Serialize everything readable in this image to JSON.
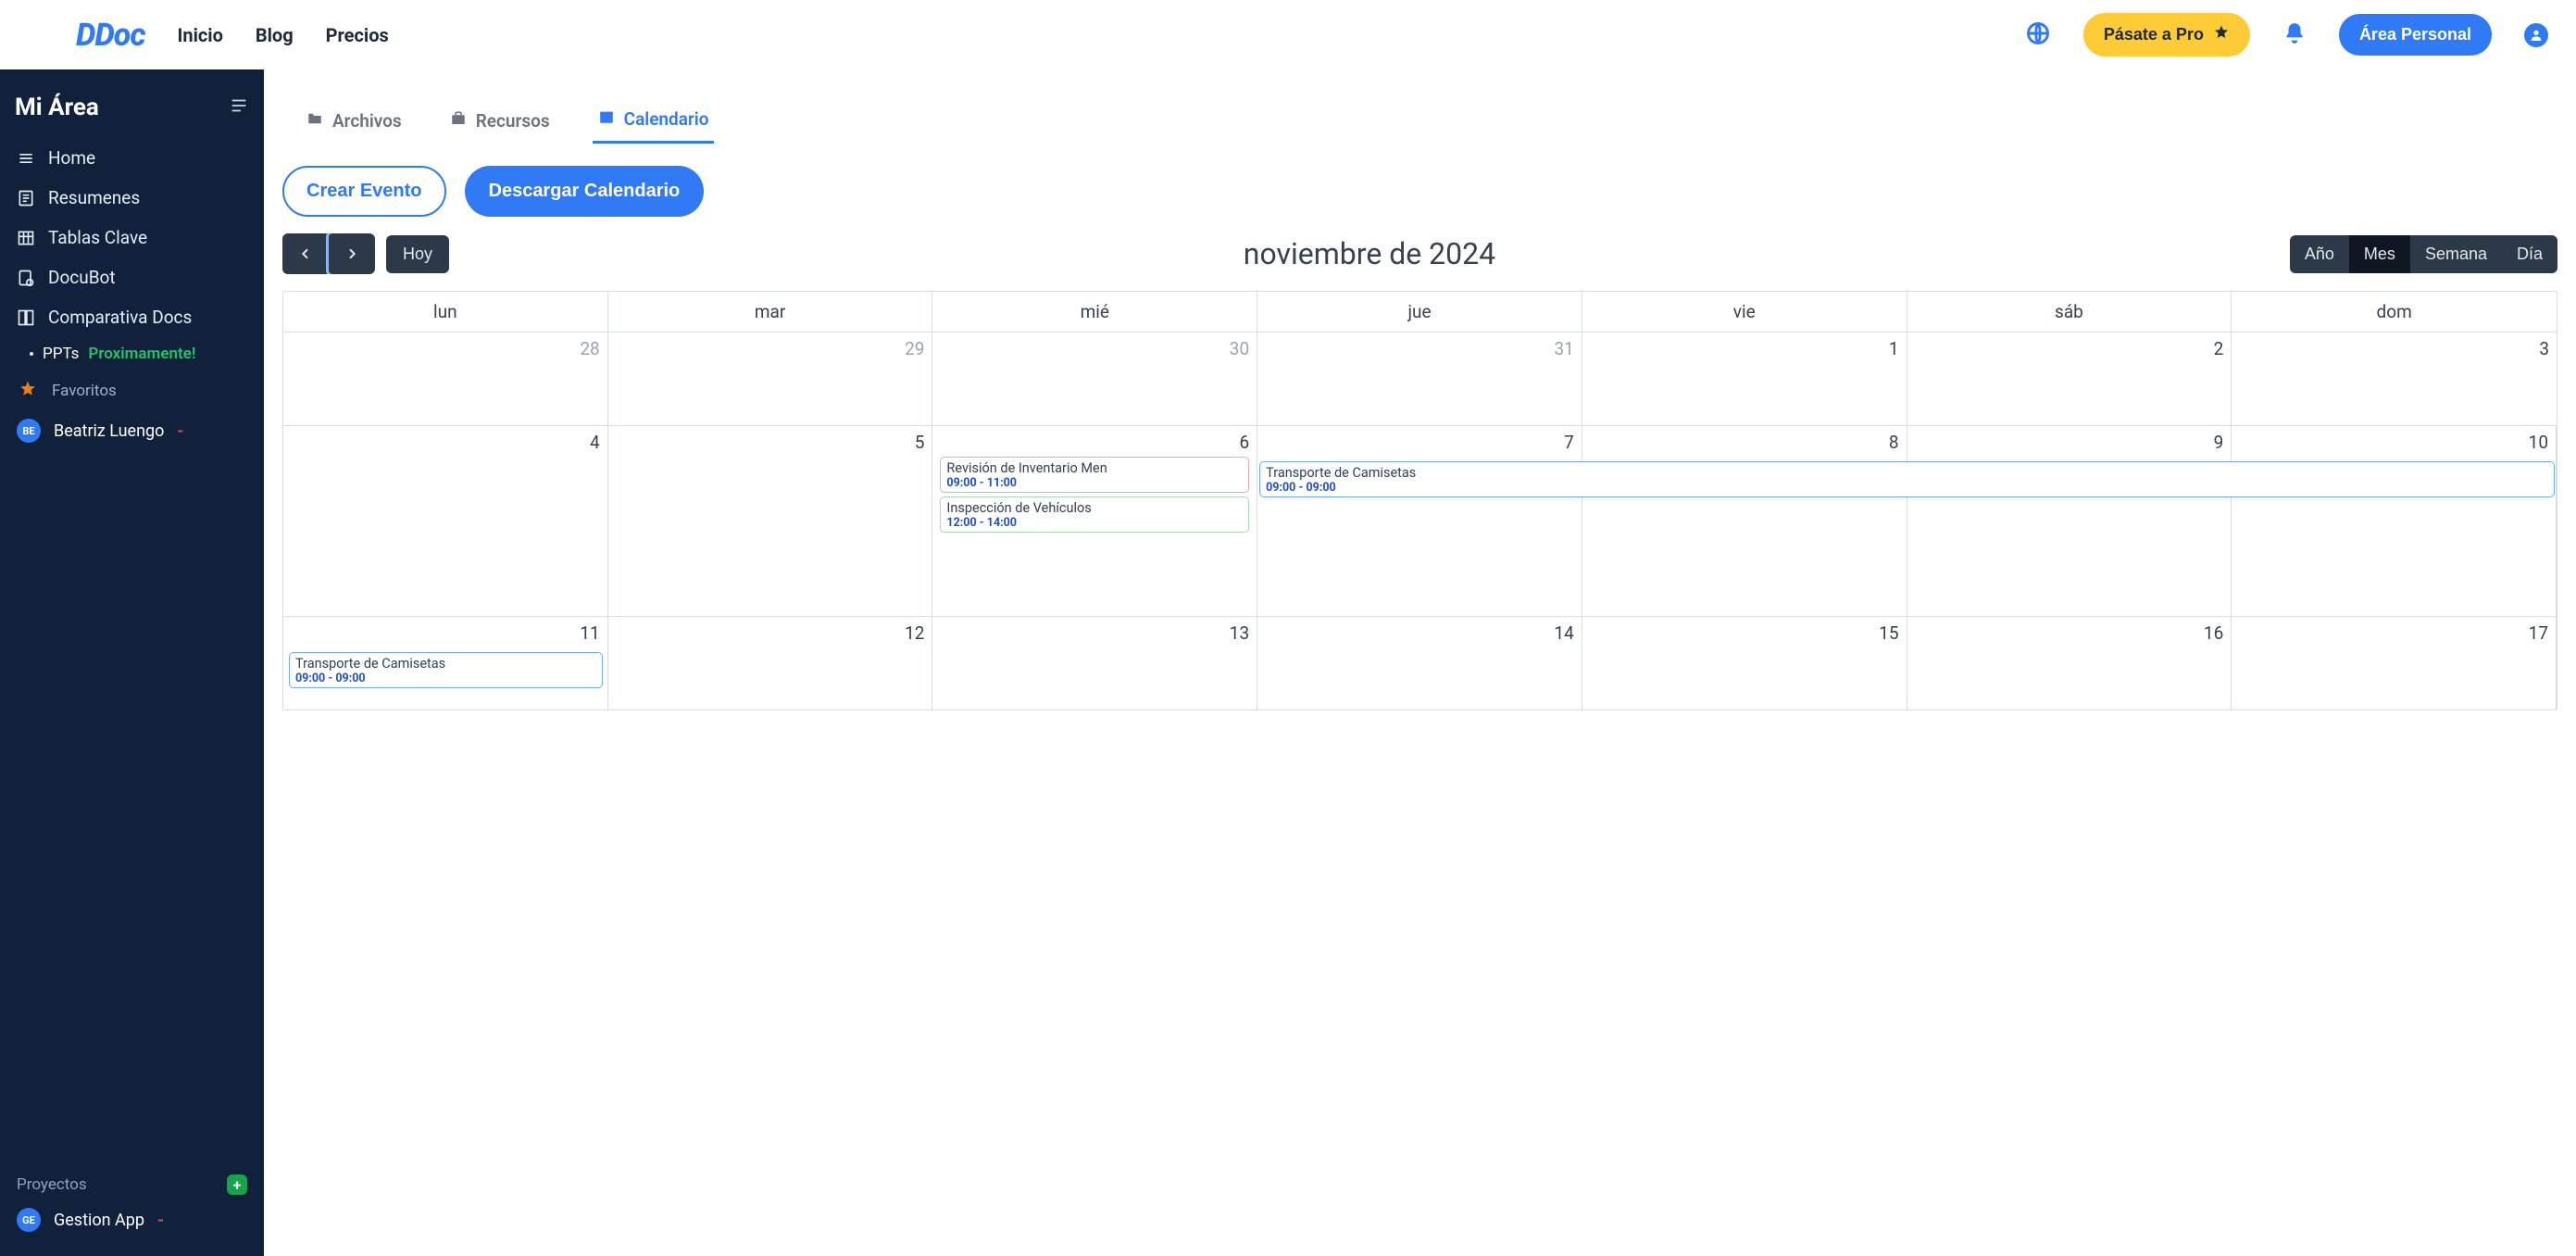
{
  "nav": {
    "logo": "DDoc",
    "links": [
      "Inicio",
      "Blog",
      "Precios"
    ],
    "pro_label": "Pásate a Pro",
    "area_label": "Área Personal"
  },
  "sidebar": {
    "title": "Mi Área",
    "items": [
      {
        "icon": "home",
        "label": "Home"
      },
      {
        "icon": "doc",
        "label": "Resumenes"
      },
      {
        "icon": "table",
        "label": "Tablas Clave"
      },
      {
        "icon": "bot",
        "label": "DocuBot"
      },
      {
        "icon": "compare",
        "label": "Comparativa Docs"
      }
    ],
    "ppt_label": "PPTs",
    "ppt_soon": "Proximamente!",
    "fav_label": "Favoritos",
    "user": {
      "initials": "BE",
      "name": "Beatriz Luengo",
      "action": "-"
    },
    "projects_label": "Proyectos",
    "project": {
      "initials": "GE",
      "name": "Gestion App",
      "action": "-"
    }
  },
  "tabs": {
    "files": "Archivos",
    "resources": "Recursos",
    "calendar": "Calendario"
  },
  "actions": {
    "create": "Crear Evento",
    "download": "Descargar Calendario"
  },
  "calendar": {
    "today": "Hoy",
    "title": "noviembre de 2024",
    "views": [
      "Año",
      "Mes",
      "Semana",
      "Día"
    ],
    "active_view": "Mes",
    "weekdays": [
      "lun",
      "mar",
      "mié",
      "jue",
      "vie",
      "sáb",
      "dom"
    ],
    "rows": [
      [
        {
          "n": "28",
          "o": true
        },
        {
          "n": "29",
          "o": true
        },
        {
          "n": "30",
          "o": true
        },
        {
          "n": "31",
          "o": true
        },
        {
          "n": "1"
        },
        {
          "n": "2"
        },
        {
          "n": "3"
        }
      ],
      [
        {
          "n": "4"
        },
        {
          "n": "5"
        },
        {
          "n": "6"
        },
        {
          "n": "7"
        },
        {
          "n": "8"
        },
        {
          "n": "9"
        },
        {
          "n": "10"
        }
      ],
      [
        {
          "n": "11"
        },
        {
          "n": "12"
        },
        {
          "n": "13"
        },
        {
          "n": "14"
        },
        {
          "n": "15"
        },
        {
          "n": "16"
        },
        {
          "n": "17"
        }
      ]
    ],
    "events_day6": [
      {
        "title": "Revisión de Inventario Men",
        "time": "09:00 - 11:00",
        "cls": "ev-red"
      },
      {
        "title": "Inspección de Vehículos",
        "time": "12:00 - 14:00",
        "cls": "ev-green"
      }
    ],
    "multi_event": {
      "title": "Transporte de Camisetas",
      "time": "09:00 - 09:00",
      "cls": "ev-blue"
    },
    "event_day11": {
      "title": "Transporte de Camisetas",
      "time": "09:00 - 09:00",
      "cls": "ev-blue"
    }
  }
}
